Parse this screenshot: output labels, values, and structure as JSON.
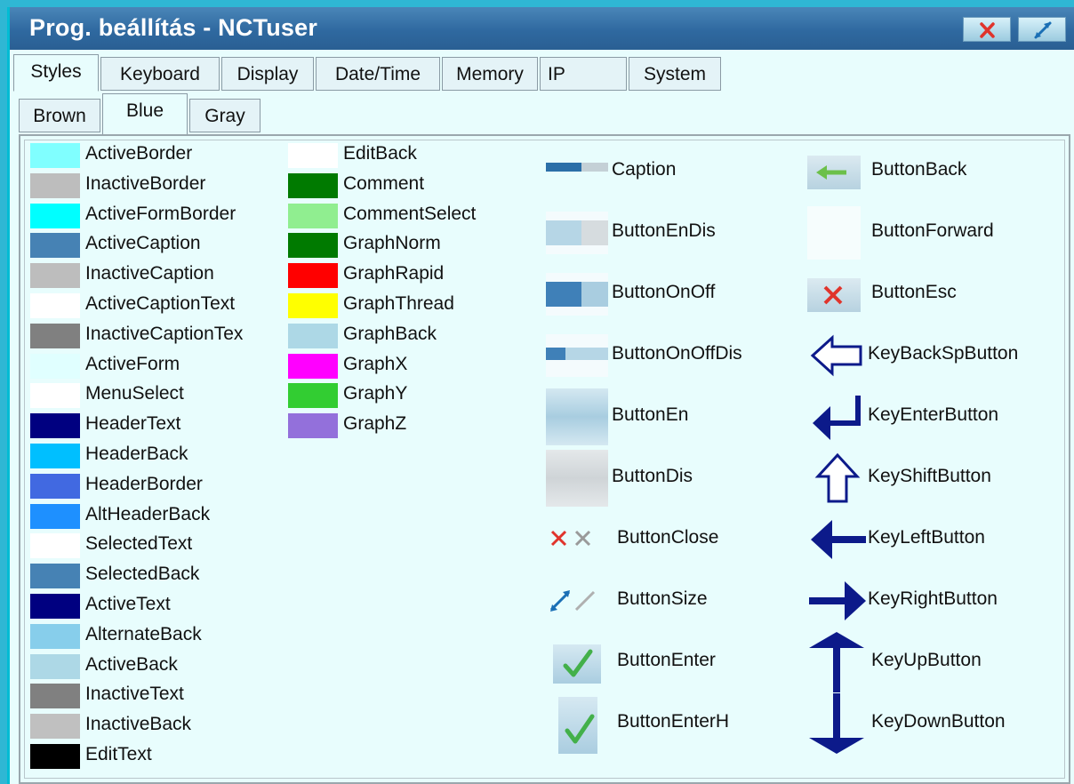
{
  "window": {
    "title": "Prog. beállítás - NCTuser",
    "close_icon": "close-icon",
    "resize_icon": "resize-icon"
  },
  "main_tabs": [
    "Styles",
    "Keyboard",
    "Display",
    "Date/Time",
    "Memory",
    "IP",
    "System"
  ],
  "main_tabs_selected": "Styles",
  "style_tabs": [
    "Brown",
    "Blue",
    "Gray"
  ],
  "style_tabs_selected": "Blue",
  "colors_col1": [
    {
      "label": "ActiveBorder",
      "color": "#80ffff"
    },
    {
      "label": "InactiveBorder",
      "color": "#bdbdbd"
    },
    {
      "label": "ActiveFormBorder",
      "color": "#00ffff"
    },
    {
      "label": "ActiveCaption",
      "color": "#4682b4"
    },
    {
      "label": "InactiveCaption",
      "color": "#bdbdbd"
    },
    {
      "label": "ActiveCaptionText",
      "color": "#ffffff"
    },
    {
      "label": "InactiveCaptionTex",
      "color": "#808080"
    },
    {
      "label": "ActiveForm",
      "color": "#e0ffff"
    },
    {
      "label": "MenuSelect",
      "color": "#ffffff"
    },
    {
      "label": "HeaderText",
      "color": "#000080"
    },
    {
      "label": "HeaderBack",
      "color": "#00bfff"
    },
    {
      "label": "HeaderBorder",
      "color": "#4169e1"
    },
    {
      "label": "AltHeaderBack",
      "color": "#1e90ff"
    },
    {
      "label": "SelectedText",
      "color": "#ffffff"
    },
    {
      "label": "SelectedBack",
      "color": "#4682b4"
    },
    {
      "label": "ActiveText",
      "color": "#000080"
    },
    {
      "label": "AlternateBack",
      "color": "#87ceeb"
    },
    {
      "label": "ActiveBack",
      "color": "#add8e6"
    },
    {
      "label": "InactiveText",
      "color": "#808080"
    },
    {
      "label": "InactiveBack",
      "color": "#c0c0c0"
    },
    {
      "label": "EditText",
      "color": "#000000"
    }
  ],
  "colors_col2": [
    {
      "label": "EditBack",
      "color": "#ffffff"
    },
    {
      "label": "Comment",
      "color": "#007a00"
    },
    {
      "label": "CommentSelect",
      "color": "#90ee90"
    },
    {
      "label": "GraphNorm",
      "color": "#007a00"
    },
    {
      "label": "GraphRapid",
      "color": "#ff0000"
    },
    {
      "label": "GraphThread",
      "color": "#ffff00"
    },
    {
      "label": "GraphBack",
      "color": "#add8e6"
    },
    {
      "label": "GraphX",
      "color": "#ff00ff"
    },
    {
      "label": "GraphY",
      "color": "#32cd32"
    },
    {
      "label": "GraphZ",
      "color": "#9370db"
    }
  ],
  "icons_col3": [
    {
      "label": "Caption",
      "icon": "caption-bar-icon"
    },
    {
      "label": "ButtonEnDis",
      "icon": "button-en-dis-icon"
    },
    {
      "label": "ButtonOnOff",
      "icon": "button-on-off-icon"
    },
    {
      "label": "ButtonOnOffDis",
      "icon": "button-on-off-dis-icon"
    },
    {
      "label": "ButtonEn",
      "icon": "button-en-icon"
    },
    {
      "label": "ButtonDis",
      "icon": "button-dis-icon"
    },
    {
      "label": "ButtonClose",
      "icon": "close-icon"
    },
    {
      "label": "ButtonSize",
      "icon": "resize-icon"
    },
    {
      "label": "ButtonEnter",
      "icon": "check-icon"
    },
    {
      "label": "ButtonEnterH",
      "icon": "check-icon"
    }
  ],
  "icons_col4": [
    {
      "label": "ButtonBack",
      "icon": "back-arrow-icon"
    },
    {
      "label": "ButtonForward",
      "icon": "blank-icon"
    },
    {
      "label": "ButtonEsc",
      "icon": "esc-x-icon"
    },
    {
      "label": "KeyBackSpButton",
      "icon": "backspace-arrow-icon"
    },
    {
      "label": "KeyEnterButton",
      "icon": "enter-arrow-icon"
    },
    {
      "label": "KeyShiftButton",
      "icon": "shift-arrow-icon"
    },
    {
      "label": "KeyLeftButton",
      "icon": "left-arrow-icon"
    },
    {
      "label": "KeyRightButton",
      "icon": "right-arrow-icon"
    },
    {
      "label": "KeyUpButton",
      "icon": "up-arrow-icon"
    },
    {
      "label": "KeyDownButton",
      "icon": "down-arrow-icon"
    }
  ]
}
